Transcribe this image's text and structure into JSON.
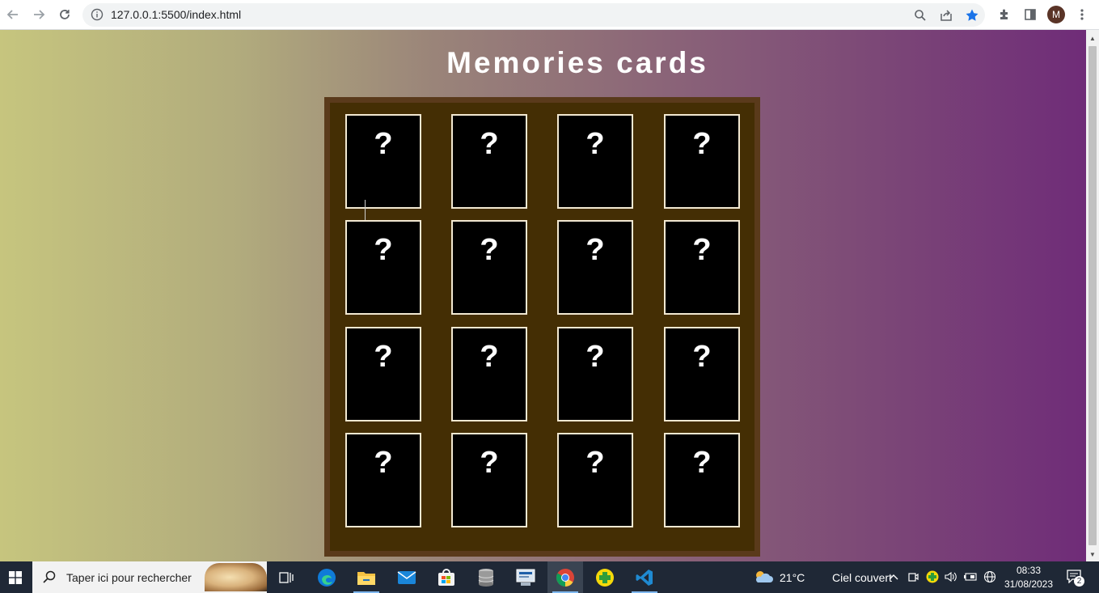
{
  "browser": {
    "url": "127.0.0.1:5500/index.html",
    "profile_initial": "M",
    "icons": [
      "back-icon",
      "forward-icon",
      "reload-icon",
      "info-icon",
      "zoom-icon",
      "share-icon",
      "bookmark-star-icon",
      "extensions-icon",
      "side-panel-icon",
      "menu-icon"
    ],
    "accent": "#1a73e8"
  },
  "page": {
    "title": "Memories cards",
    "card_symbol": "?",
    "cards": [
      {
        "face": "?"
      },
      {
        "face": "?"
      },
      {
        "face": "?"
      },
      {
        "face": "?"
      },
      {
        "face": "?"
      },
      {
        "face": "?"
      },
      {
        "face": "?"
      },
      {
        "face": "?"
      },
      {
        "face": "?"
      },
      {
        "face": "?"
      },
      {
        "face": "?"
      },
      {
        "face": "?"
      },
      {
        "face": "?"
      },
      {
        "face": "?"
      },
      {
        "face": "?"
      },
      {
        "face": "?"
      }
    ],
    "colors": {
      "board": "#442e04",
      "board_border": "#5a3a1b",
      "card_back": "#000000",
      "gradient_left": "#c6c57e",
      "gradient_right": "#6f2c78"
    }
  },
  "taskbar": {
    "search_placeholder": "Taper ici pour rechercher",
    "apps": [
      "task-view-icon",
      "edge-icon",
      "file-explorer-icon",
      "mail-icon",
      "store-icon",
      "database-icon",
      "network-tool-icon",
      "chrome-icon",
      "health-app-icon",
      "vscode-icon"
    ],
    "weather": {
      "temp": "21°C",
      "condition": "Ciel couvert"
    },
    "time": "08:33",
    "date": "31/08/2023",
    "notification_count": "2"
  }
}
